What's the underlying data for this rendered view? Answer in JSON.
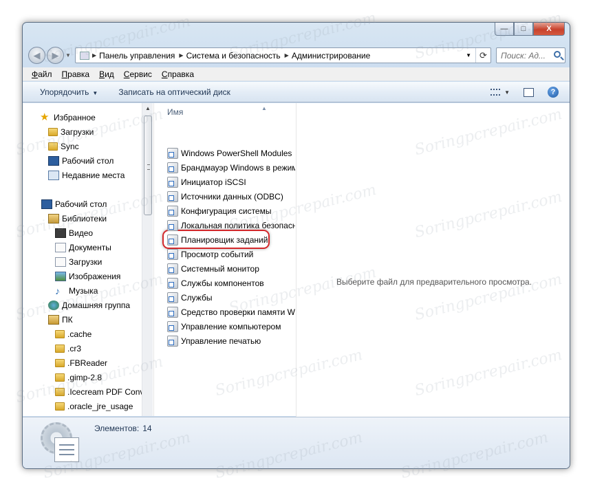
{
  "window": {
    "caption_buttons": {
      "minimize": "—",
      "maximize": "□",
      "close": "X"
    }
  },
  "address": {
    "path": [
      "Панель управления",
      "Система и безопасность",
      "Администрирование"
    ],
    "search_placeholder": "Поиск: Ад..."
  },
  "menu": [
    "Файл",
    "Правка",
    "Вид",
    "Сервис",
    "Справка"
  ],
  "commands": {
    "organize": "Упорядочить",
    "burn": "Записать на оптический диск"
  },
  "nav_pane": {
    "items": [
      {
        "label": "Избранное",
        "icon": "star-icon"
      },
      {
        "label": "Загрузки",
        "icon": "downloads-folder-icon"
      },
      {
        "label": "Sync",
        "icon": "folder-icon"
      },
      {
        "label": "Рабочий стол",
        "icon": "desktop-icon"
      },
      {
        "label": "Недавние места",
        "icon": "recent-places-icon"
      },
      {
        "label": "Рабочий стол",
        "icon": "desktop-icon"
      },
      {
        "label": "Библиотеки",
        "icon": "libraries-icon"
      },
      {
        "label": "Видео",
        "icon": "video-library-icon"
      },
      {
        "label": "Документы",
        "icon": "documents-library-icon"
      },
      {
        "label": "Загрузки",
        "icon": "downloads-library-icon"
      },
      {
        "label": "Изображения",
        "icon": "pictures-library-icon"
      },
      {
        "label": "Музыка",
        "icon": "music-library-icon"
      },
      {
        "label": "Домашняя группа",
        "icon": "homegroup-icon"
      },
      {
        "label": "ПК",
        "icon": "computer-icon"
      },
      {
        "label": ".cache",
        "icon": "folder-icon"
      },
      {
        "label": ".cr3",
        "icon": "folder-icon"
      },
      {
        "label": ".FBReader",
        "icon": "folder-icon"
      },
      {
        "label": ".gimp-2.8",
        "icon": "folder-icon"
      },
      {
        "label": ".Icecream PDF Conv",
        "icon": "folder-icon"
      },
      {
        "label": ".oracle_jre_usage",
        "icon": "folder-icon"
      }
    ]
  },
  "file_list": {
    "column_header": "Имя",
    "items": [
      "Windows PowerShell Modules",
      "Брандмауэр Windows в режиме",
      "Инициатор iSCSI",
      "Источники данных (ODBC)",
      "Конфигурация системы",
      "Локальная политика безопасности",
      "Планировщик заданий",
      "Просмотр событий",
      "Системный монитор",
      "Службы компонентов",
      "Службы",
      "Средство проверки памяти Windows",
      "Управление компьютером",
      "Управление печатью"
    ],
    "highlighted": "Планировщик заданий"
  },
  "preview": {
    "message": "Выберите файл для предварительного просмотра."
  },
  "details": {
    "count_label": "Элементов:",
    "count_value": "14"
  },
  "watermark": "Soringpcrepair.com",
  "colors": {
    "highlight_ring": "#d3282b",
    "link_text": "#1e3452"
  }
}
